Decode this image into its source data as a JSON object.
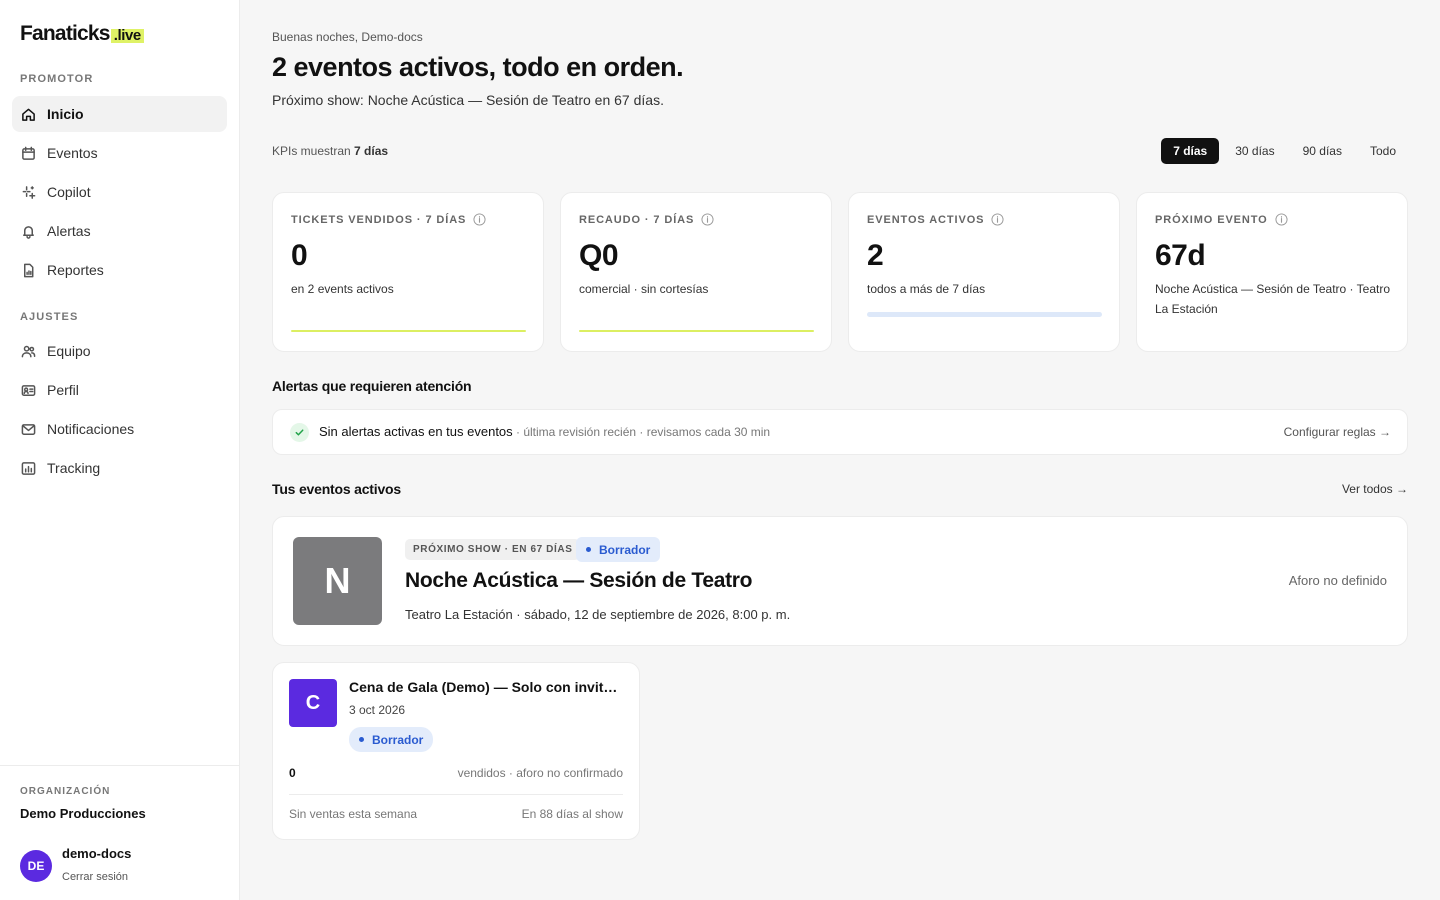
{
  "brand": {
    "name": "Fanaticks",
    "suffix": ".live",
    "accent": "#dff266"
  },
  "sidebar": {
    "section_promotor": "PROMOTOR",
    "section_ajustes": "AJUSTES",
    "items": [
      {
        "label": "Inicio",
        "icon": "home-icon"
      },
      {
        "label": "Eventos",
        "icon": "calendar-icon"
      },
      {
        "label": "Copilot",
        "icon": "sparkles-icon"
      },
      {
        "label": "Alertas",
        "icon": "bell-icon"
      },
      {
        "label": "Reportes",
        "icon": "report-icon"
      },
      {
        "label": "Equipo",
        "icon": "team-icon"
      },
      {
        "label": "Perfil",
        "icon": "id-card-icon"
      },
      {
        "label": "Notificaciones",
        "icon": "mail-icon"
      },
      {
        "label": "Tracking",
        "icon": "chart-icon"
      }
    ],
    "org_label": "ORGANIZACIÓN",
    "org_name": "Demo Producciones",
    "user": {
      "initials": "DE",
      "name": "demo-docs",
      "logout": "Cerrar sesión"
    }
  },
  "header": {
    "greeting": "Buenas noches, Demo-docs",
    "headline": "2 eventos activos, todo en orden.",
    "subline": "Próximo show: Noche Acústica — Sesión de Teatro en 67 días."
  },
  "kpi_range": {
    "note_prefix": "KPIs muestran",
    "note_value": "7 días",
    "tabs": [
      "7 días",
      "30 días",
      "90 días",
      "Todo"
    ],
    "active": "7 días"
  },
  "kpis": [
    {
      "title": "TICKETS VENDIDOS · 7 DÍAS",
      "value": "0",
      "sub": "en 2 events activos"
    },
    {
      "title": "RECAUDO · 7 DÍAS",
      "value": "Q0",
      "sub": "comercial · sin cortesías"
    },
    {
      "title": "EVENTOS ACTIVOS",
      "value": "2",
      "sub": "todos a más de 7 días"
    },
    {
      "title": "PRÓXIMO EVENTO",
      "value": "67d",
      "sub": "Noche Acústica — Sesión de Teatro · Teatro La Estación"
    }
  ],
  "alerts": {
    "title": "Alertas que requieren atención",
    "message": "Sin alertas activas en tus eventos",
    "meta": "· última revisión recién · revisamos cada 30 min",
    "link": "Configurar reglas →"
  },
  "events": {
    "title": "Tus eventos activos",
    "see_all": "Ver todos →",
    "featured": {
      "initial": "N",
      "badge": "PRÓXIMO SHOW · EN 67 DÍAS",
      "status": "Borrador",
      "name": "Noche Acústica — Sesión de Teatro",
      "meta": "Teatro La Estación · sábado, 12 de septiembre de 2026, 8:00 p. m.",
      "capacity": "Aforo no definido"
    },
    "cards": [
      {
        "initial": "C",
        "name": "Cena de Gala (Demo) — Solo con invitación",
        "date": "3 oct 2026",
        "status": "Borrador",
        "sold": "0",
        "sold_label": "vendidos · aforo no confirmado",
        "footer_left": "Sin ventas esta semana",
        "footer_right": "En 88 días al show"
      }
    ]
  },
  "colors": {
    "accent_purple": "#5b2ae0",
    "status_blue": "#2a5bd0",
    "accent_lime": "#dcef62"
  }
}
